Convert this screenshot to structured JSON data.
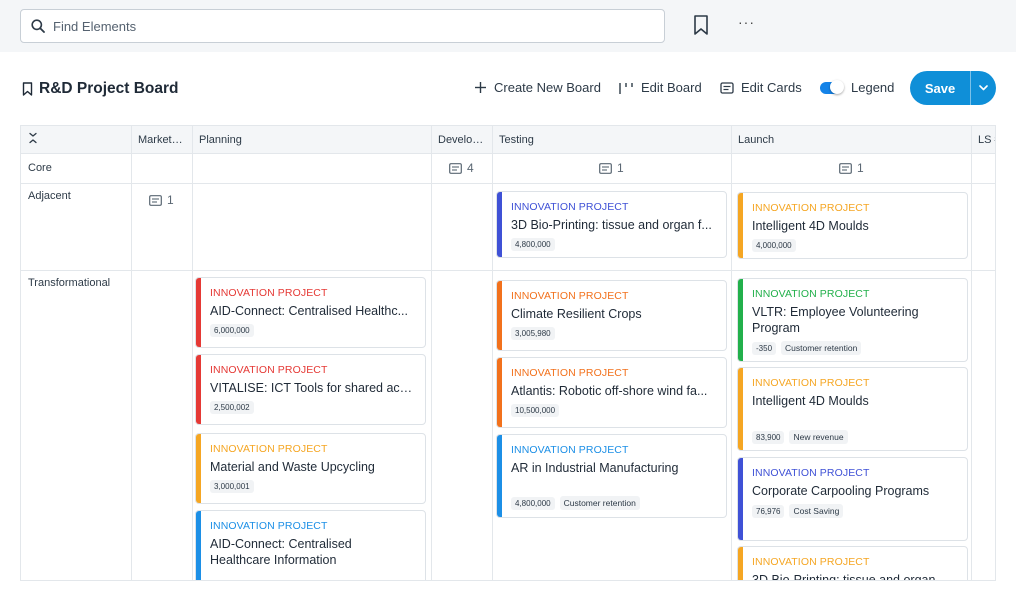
{
  "search": {
    "placeholder": "Find Elements"
  },
  "toolbar": {
    "more": "···"
  },
  "board": {
    "title": "R&D Project Board",
    "create": "Create New Board",
    "edit_board": "Edit Board",
    "edit_cards": "Edit Cards",
    "legend": "Legend",
    "save": "Save"
  },
  "columns": [
    "Market…",
    "Planning",
    "Develo…",
    "Testing",
    "Launch",
    "LS #"
  ],
  "rows": [
    "Core",
    "Adjacent",
    "Transformational"
  ],
  "counts": {
    "core_dev": "4",
    "core_testing": "1",
    "core_launch": "1",
    "adjacent_market": "1"
  },
  "colors": {
    "red": "#e53935",
    "orange": "#f2711c",
    "amber": "#f5a623",
    "blue": "#1c8fe6",
    "indigo": "#3f51d6",
    "green": "#22b04b",
    "accent": "#0f8fd8"
  },
  "cards": {
    "adj_testing": {
      "kind": "INNOVATION PROJECT",
      "title": "3D Bio-Printing: tissue and organ f...",
      "value": "4,800,000"
    },
    "adj_launch": {
      "kind": "INNOVATION PROJECT",
      "title": "Intelligent 4D Moulds",
      "value": "4,000,000"
    },
    "plan1": {
      "kind": "INNOVATION PROJECT",
      "title": "AID-Connect: Centralised Healthc...",
      "value": "6,000,000"
    },
    "plan2": {
      "kind": "INNOVATION PROJECT",
      "title": "VITALISE: ICT Tools for shared acc...",
      "value": "2,500,002"
    },
    "plan3": {
      "kind": "INNOVATION PROJECT",
      "title": "Material and Waste Upcycling",
      "value": "3,000,001"
    },
    "plan4": {
      "kind": "INNOVATION PROJECT",
      "title": "AID-Connect: Centralised Healthcare Information"
    },
    "test1": {
      "kind": "INNOVATION PROJECT",
      "title": "Climate Resilient Crops",
      "value": "3,005,980"
    },
    "test2": {
      "kind": "INNOVATION PROJECT",
      "title": "Atlantis: Robotic off-shore wind fa...",
      "value": "10,500,000"
    },
    "test3": {
      "kind": "INNOVATION PROJECT",
      "title": "AR in Industrial Manufacturing",
      "value": "4,800,000",
      "tag": "Customer retention"
    },
    "launch1": {
      "kind": "INNOVATION PROJECT",
      "title": "VLTR: Employee Volunteering Program",
      "value": "-350",
      "tag": "Customer retention"
    },
    "launch2": {
      "kind": "INNOVATION PROJECT",
      "title": "Intelligent 4D Moulds",
      "value": "83,900",
      "tag": "New revenue"
    },
    "launch3": {
      "kind": "INNOVATION PROJECT",
      "title": "Corporate Carpooling Programs",
      "value": "76,976",
      "tag": "Cost Saving"
    },
    "launch4": {
      "kind": "INNOVATION PROJECT",
      "title": "3D Bio-Printing: tissue and organ"
    }
  }
}
